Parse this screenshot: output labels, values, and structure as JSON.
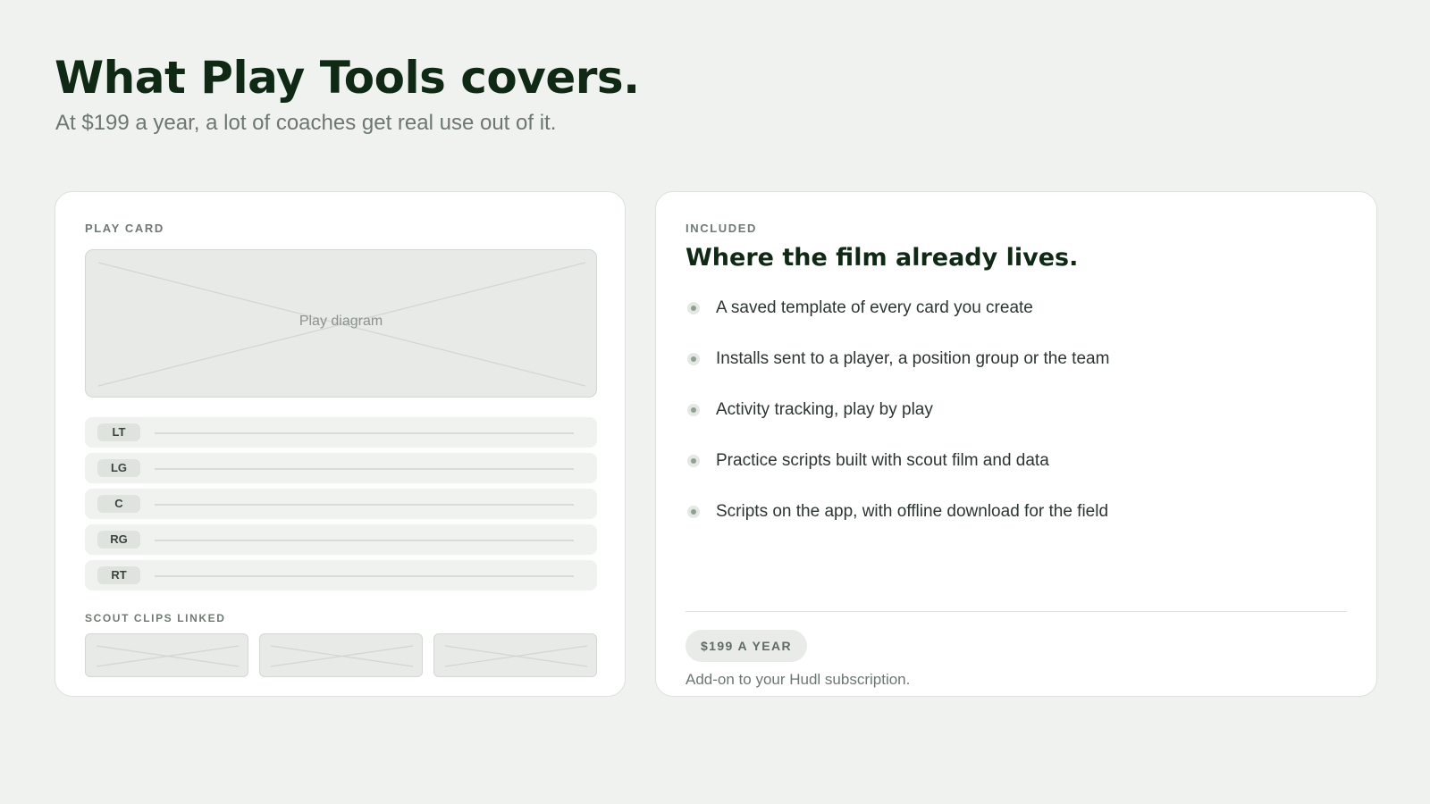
{
  "header": {
    "title": "What Play Tools covers.",
    "subtitle": "At $199 a year, a lot of coaches get real use out of it."
  },
  "play_card": {
    "eyebrow": "PLAY CARD",
    "diagram_label": "Play diagram",
    "positions": [
      {
        "label": "LT"
      },
      {
        "label": "LG"
      },
      {
        "label": "C"
      },
      {
        "label": "RG"
      },
      {
        "label": "RT"
      }
    ],
    "scout_label": "SCOUT CLIPS LINKED",
    "scout_clips_count": 3
  },
  "included": {
    "eyebrow": "INCLUDED",
    "heading": "Where the film already lives.",
    "features": [
      "A saved template of every card you create",
      "Installs sent to a player, a position group or the team",
      "Activity tracking, play by play",
      "Practice scripts built with scout film and data",
      "Scripts on the app, with offline download for the field"
    ],
    "price_badge": "$199 A YEAR",
    "price_note": "Add-on to your Hudl subscription."
  },
  "colors": {
    "background": "#f0f2ef",
    "title": "#0f2915",
    "placeholder": "#e7eae6",
    "bullet_dot": "#8fa093"
  }
}
